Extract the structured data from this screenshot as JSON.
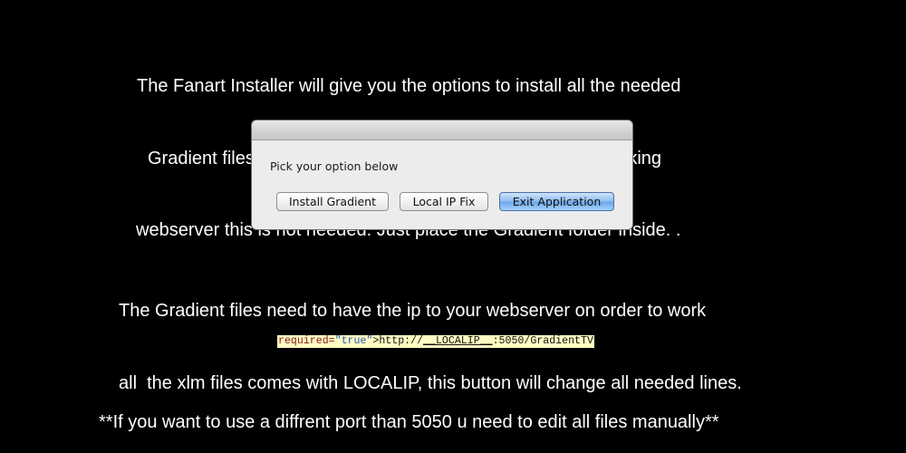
{
  "intro": {
    "line1": "The Fanart Installer will give you the options to install all the needed",
    "line2": "Gradient files need for that option, If you already have a working",
    "line3": "webserver this is not needed. Just place the Gradient folder inside. ."
  },
  "dialog": {
    "prompt": "Pick your option below",
    "buttons": {
      "install": "Install Gradient",
      "local_ip": "Local IP Fix",
      "exit": "Exit Application"
    }
  },
  "middle": {
    "line1": "The Gradient files need to have the ip to your webserver on order to work",
    "line2": "all  the xlm files comes with LOCALIP, this button will change all needed lines."
  },
  "code_snippet": {
    "attr": "required=",
    "value": "\"true\"",
    "text_before": ">http://",
    "underlined": "__LOCALIP__",
    "text_after": ":5050/GradientTV"
  },
  "footer": {
    "note": "**If you want to use a diffrent port than 5050 u need to edit all files manually**"
  }
}
